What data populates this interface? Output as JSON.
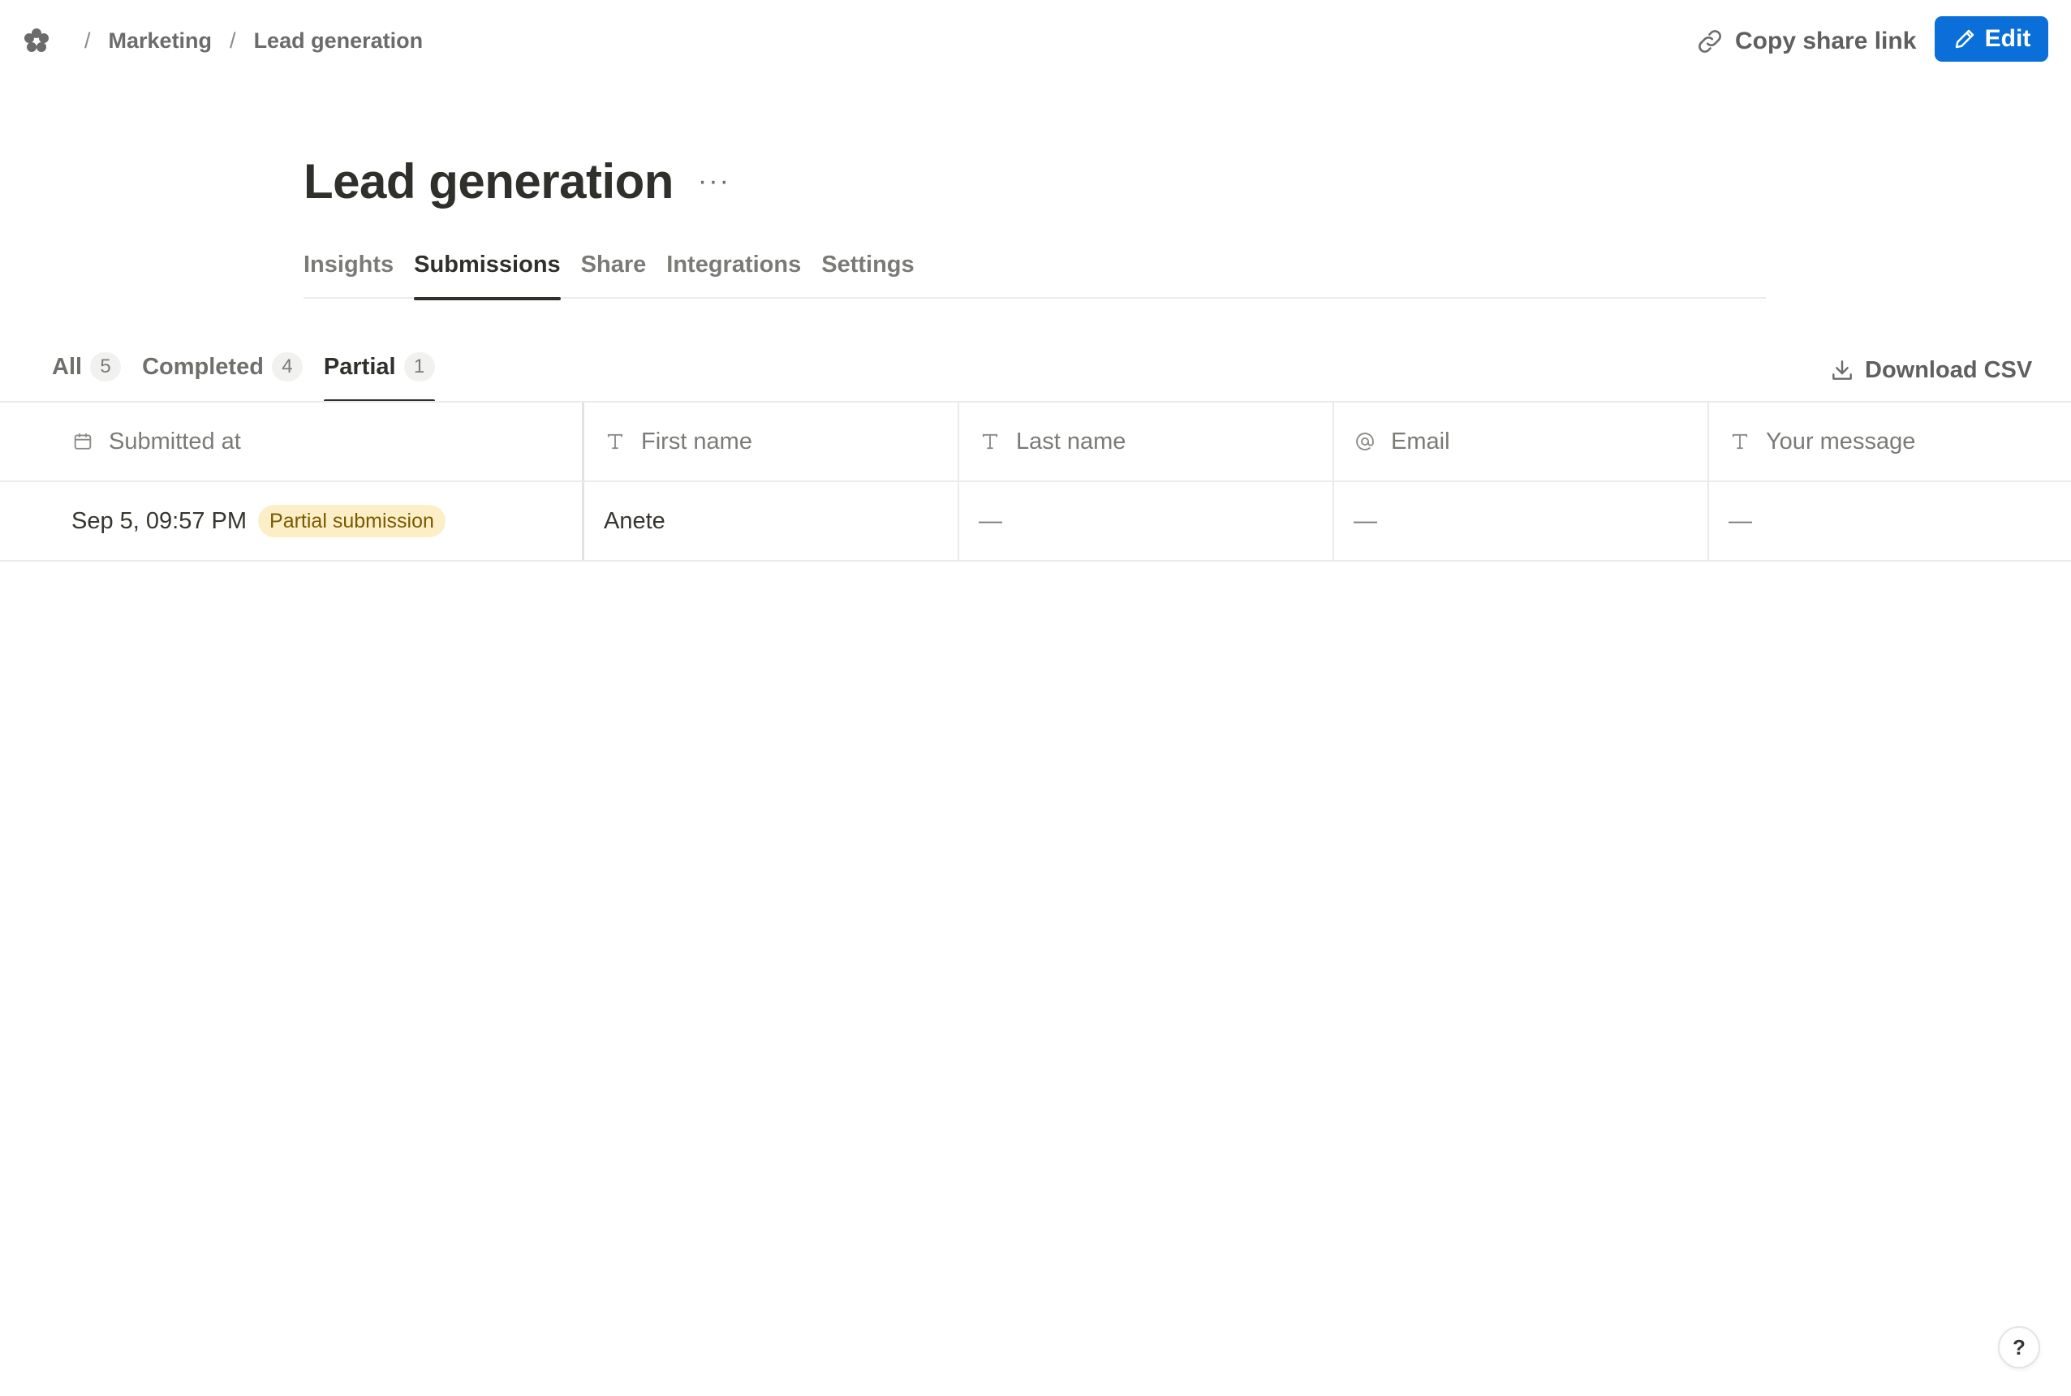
{
  "breadcrumb": {
    "workspace_icon": "flower-logo-icon",
    "items": [
      "Marketing",
      "Lead generation"
    ]
  },
  "header": {
    "copy_link_label": "Copy share link",
    "edit_label": "Edit"
  },
  "form": {
    "title": "Lead generation",
    "more": "···"
  },
  "main_tabs": [
    "Insights",
    "Submissions",
    "Share",
    "Integrations",
    "Settings"
  ],
  "active_main_tab": "Submissions",
  "filter_tabs": [
    {
      "label": "All",
      "count": "5"
    },
    {
      "label": "Completed",
      "count": "4"
    },
    {
      "label": "Partial",
      "count": "1"
    }
  ],
  "active_filter_tab": "Partial",
  "download_label": "Download CSV",
  "table": {
    "columns": [
      {
        "label": "Submitted at",
        "icon": "calendar-icon"
      },
      {
        "label": "First name",
        "icon": "text-type-icon"
      },
      {
        "label": "Last name",
        "icon": "text-type-icon"
      },
      {
        "label": "Email",
        "icon": "at-sign-icon"
      },
      {
        "label": "Your message",
        "icon": "text-type-icon"
      }
    ],
    "rows": [
      {
        "submitted_at": "Sep 5, 09:57 PM",
        "badge": "Partial submission",
        "first_name": "Anete",
        "last_name": "—",
        "email": "—",
        "message": "—"
      }
    ]
  },
  "help_label": "?",
  "colors": {
    "accent": "#0a6fd8",
    "badge_bg": "#fcefc7",
    "badge_text": "#7a5a00"
  }
}
